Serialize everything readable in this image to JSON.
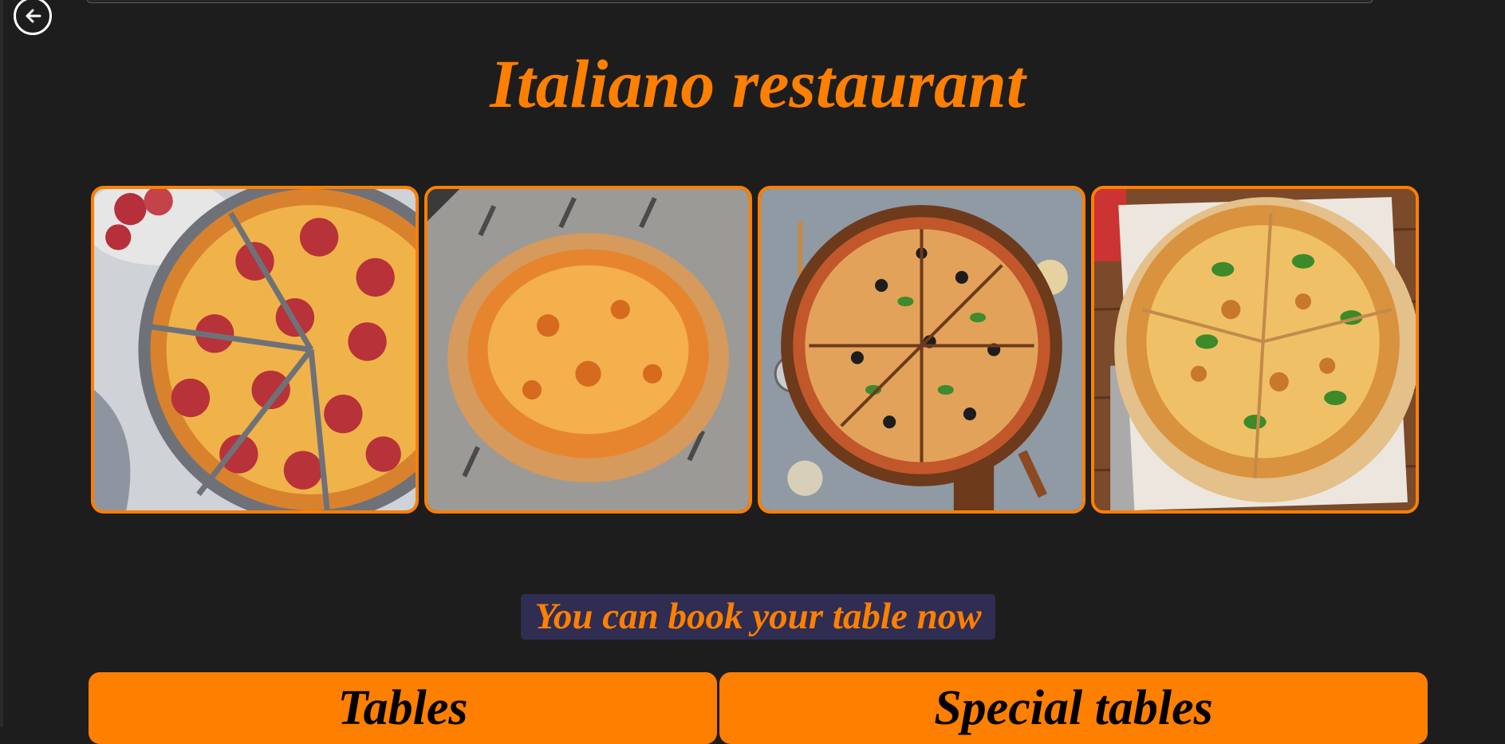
{
  "header": {
    "title": "Italiano restaurant",
    "back_icon": "arrow-left-circle-icon"
  },
  "gallery": [
    {
      "name": "pepperoni-pizza-photo"
    },
    {
      "name": "cheese-pizza-photo"
    },
    {
      "name": "supreme-pizza-photo"
    },
    {
      "name": "basil-pizza-photo"
    }
  ],
  "booking": {
    "banner_text": "You can book your table now",
    "tables_label": "Tables",
    "special_tables_label": "Special tables"
  },
  "colors": {
    "accent": "#ff7f00",
    "background": "#1d1d1d",
    "banner_bg": "#2f2d52"
  }
}
